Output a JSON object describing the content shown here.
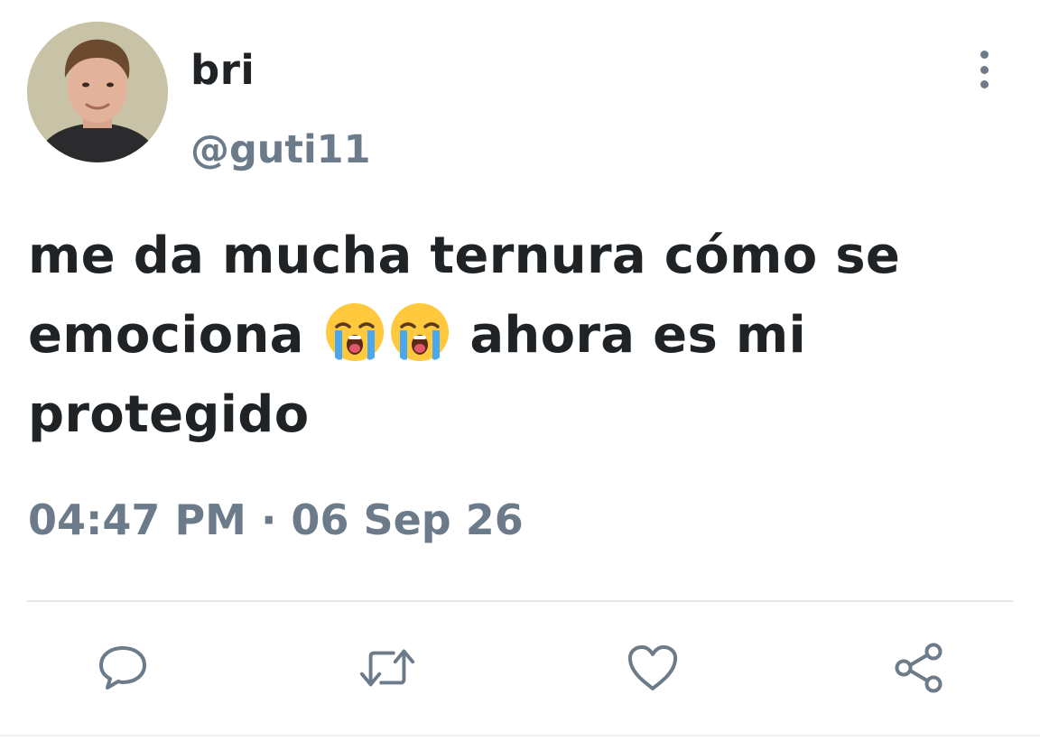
{
  "user": {
    "display_name": "bri",
    "handle": "@guti11",
    "avatar_icon": "profile-photo"
  },
  "tweet": {
    "text_before_emoji": "me da mucha ternura cómo se emociona ",
    "emoji": [
      "loudly-crying-face",
      "loudly-crying-face"
    ],
    "text_after_emoji": " ahora es mi protegido",
    "timestamp": "04:47 PM · 06 Sep 26"
  },
  "actions": [
    {
      "name": "reply",
      "icon": "comment-bubble-icon"
    },
    {
      "name": "retweet",
      "icon": "retweet-icon"
    },
    {
      "name": "like",
      "icon": "heart-icon"
    },
    {
      "name": "share",
      "icon": "share-icon"
    }
  ],
  "colors": {
    "text_primary": "#1f2326",
    "text_secondary": "#6c7b8a",
    "divider": "#e3e7ea"
  }
}
